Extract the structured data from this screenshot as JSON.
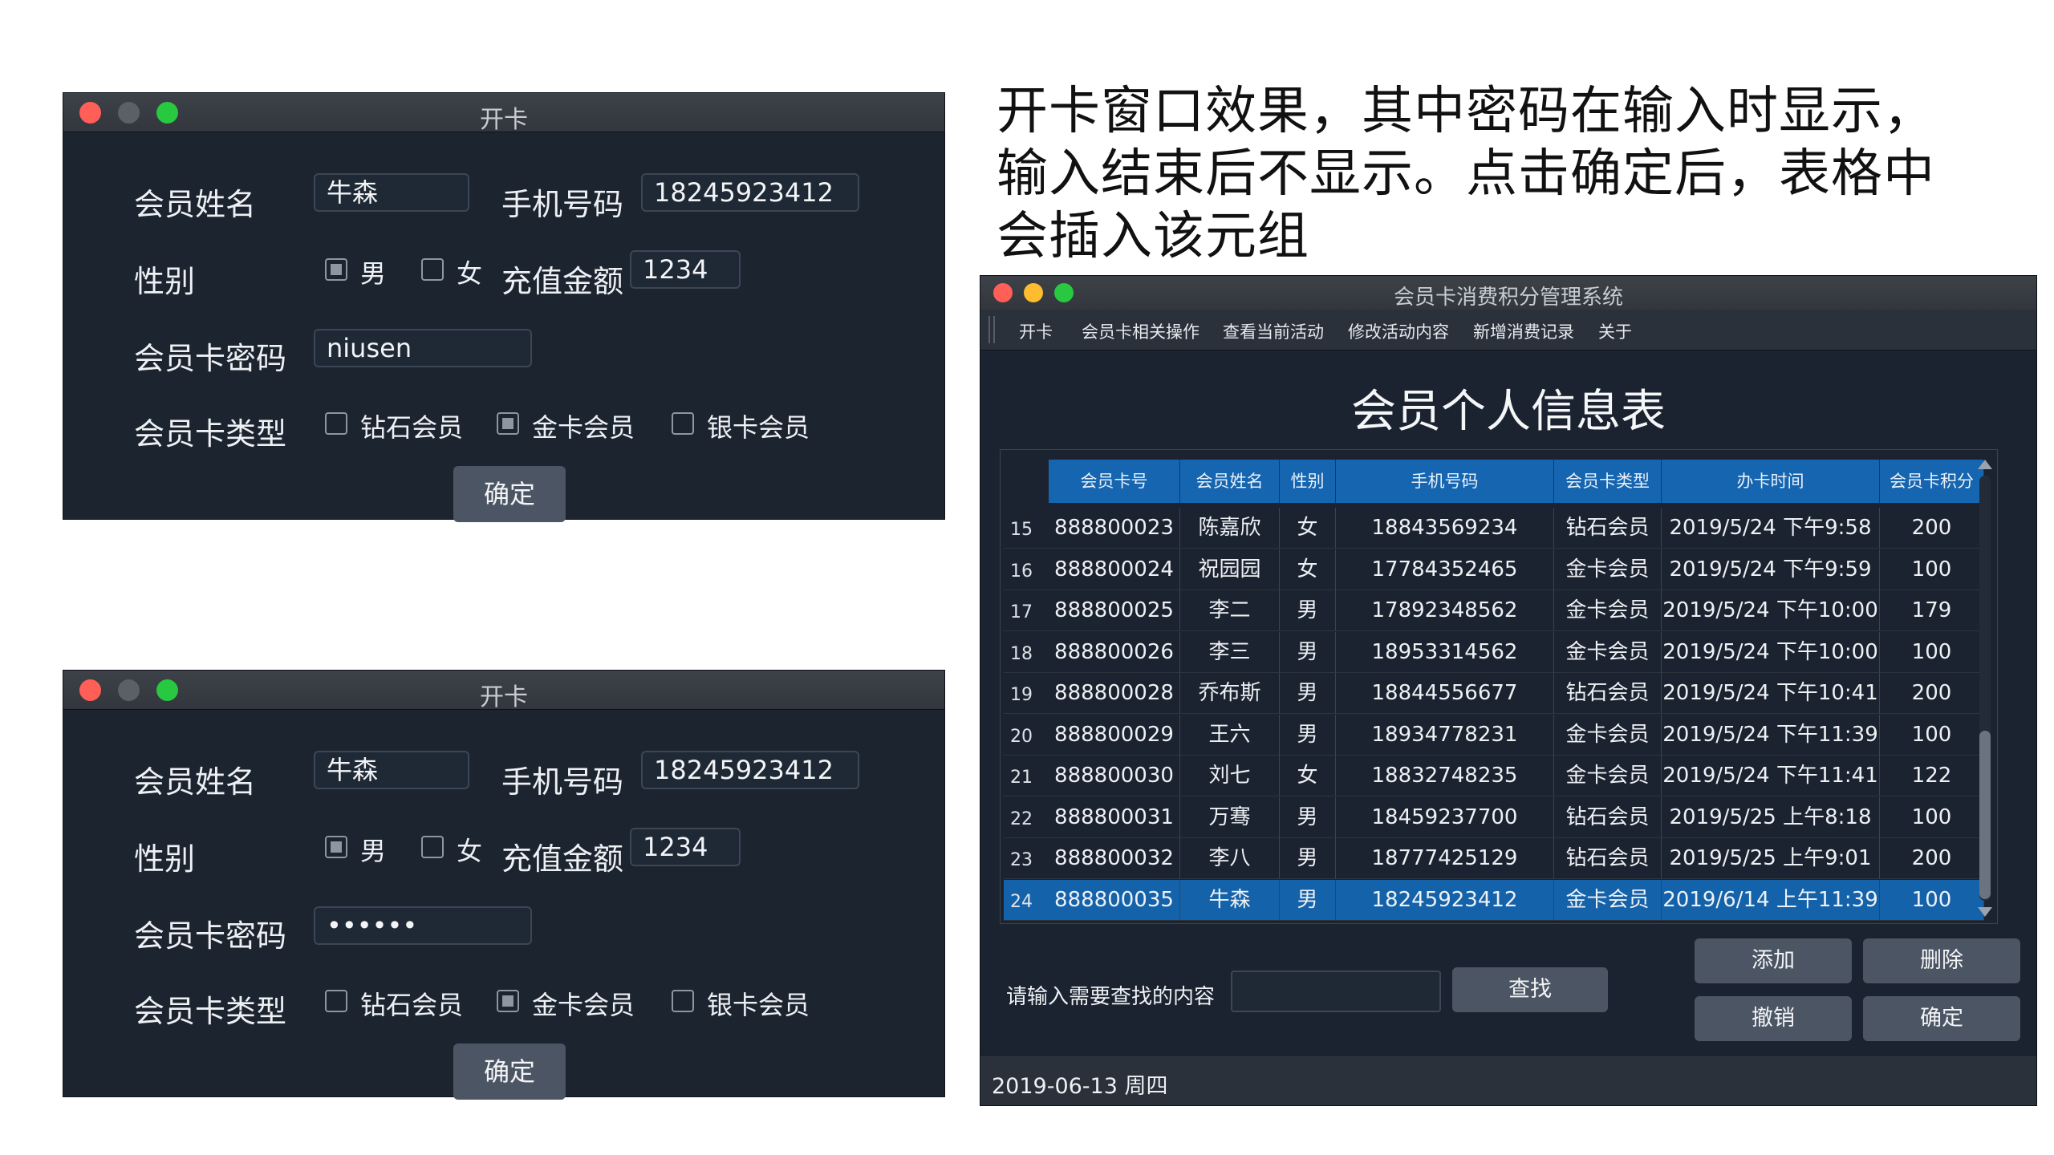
{
  "caption": "开卡窗口效果，其中密码在输入时显示，输入结束后不显示。点击确定后，表格中会插入该元组",
  "dialog_top": {
    "title": "开卡",
    "name_label": "会员姓名",
    "name_value": "牛森",
    "phone_label": "手机号码",
    "phone_value": "18245923412",
    "gender_label": "性别",
    "male": "男",
    "female": "女",
    "amount_label": "充值金额",
    "amount_value": "1234",
    "password_label": "会员卡密码",
    "password_value": "niusen",
    "type_label": "会员卡类型",
    "type_diamond": "钻石会员",
    "type_gold": "金卡会员",
    "type_silver": "银卡会员",
    "ok": "确定"
  },
  "dialog_bottom": {
    "title": "开卡",
    "name_label": "会员姓名",
    "name_value": "牛森",
    "phone_label": "手机号码",
    "phone_value": "18245923412",
    "gender_label": "性别",
    "male": "男",
    "female": "女",
    "amount_label": "充值金额",
    "amount_value": "1234",
    "password_label": "会员卡密码",
    "password_value": "••••••",
    "type_label": "会员卡类型",
    "type_diamond": "钻石会员",
    "type_gold": "金卡会员",
    "type_silver": "银卡会员",
    "ok": "确定"
  },
  "main": {
    "title": "会员卡消费积分管理系统",
    "menu": [
      "开卡",
      "会员卡相关操作",
      "查看当前活动",
      "修改活动内容",
      "新增消费记录",
      "关于"
    ],
    "heading": "会员个人信息表",
    "columns": [
      "会员卡号",
      "会员姓名",
      "性别",
      "手机号码",
      "会员卡类型",
      "办卡时间",
      "会员卡积分"
    ],
    "rows": [
      {
        "n": "15",
        "c": [
          "888800023",
          "陈嘉欣",
          "女",
          "18843569234",
          "钻石会员",
          "2019/5/24 下午9:58",
          "200"
        ]
      },
      {
        "n": "16",
        "c": [
          "888800024",
          "祝园园",
          "女",
          "17784352465",
          "金卡会员",
          "2019/5/24 下午9:59",
          "100"
        ]
      },
      {
        "n": "17",
        "c": [
          "888800025",
          "李二",
          "男",
          "17892348562",
          "金卡会员",
          "2019/5/24 下午10:00",
          "179"
        ]
      },
      {
        "n": "18",
        "c": [
          "888800026",
          "李三",
          "男",
          "18953314562",
          "金卡会员",
          "2019/5/24 下午10:00",
          "100"
        ]
      },
      {
        "n": "19",
        "c": [
          "888800028",
          "乔布斯",
          "男",
          "18844556677",
          "钻石会员",
          "2019/5/24 下午10:41",
          "200"
        ]
      },
      {
        "n": "20",
        "c": [
          "888800029",
          "王六",
          "男",
          "18934778231",
          "金卡会员",
          "2019/5/24 下午11:39",
          "100"
        ]
      },
      {
        "n": "21",
        "c": [
          "888800030",
          "刘七",
          "女",
          "18832748235",
          "金卡会员",
          "2019/5/24 下午11:41",
          "122"
        ]
      },
      {
        "n": "22",
        "c": [
          "888800031",
          "万骞",
          "男",
          "18459237700",
          "钻石会员",
          "2019/5/25 上午8:18",
          "100"
        ]
      },
      {
        "n": "23",
        "c": [
          "888800032",
          "李八",
          "男",
          "18777425129",
          "钻石会员",
          "2019/5/25 上午9:01",
          "200"
        ]
      },
      {
        "n": "24",
        "c": [
          "888800035",
          "牛森",
          "男",
          "18245923412",
          "金卡会员",
          "2019/6/14 上午11:39",
          "100"
        ]
      }
    ],
    "selected_row": "24",
    "search_label": "请输入需要查找的内容",
    "search_value": "",
    "find": "查找",
    "add": "添加",
    "delete": "删除",
    "undo": "撤销",
    "ok": "确定",
    "status": "2019-06-13 周四"
  }
}
